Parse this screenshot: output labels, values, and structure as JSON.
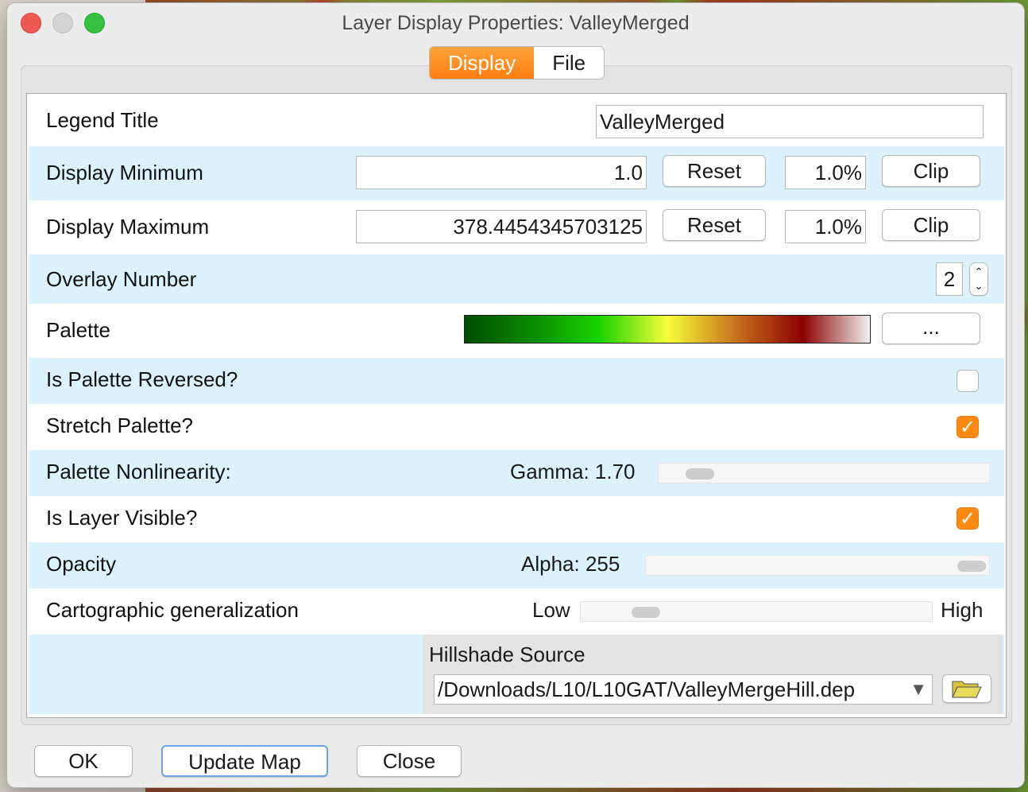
{
  "window": {
    "title": "Layer Display Properties: ValleyMerged"
  },
  "tabs": [
    {
      "label": "Display",
      "active": true
    },
    {
      "label": "File",
      "active": false
    }
  ],
  "rows": {
    "legend_title": {
      "label": "Legend Title",
      "value": "ValleyMerged"
    },
    "display_min": {
      "label": "Display Minimum",
      "value": "1.0",
      "reset_label": "Reset",
      "percent": "1.0%",
      "clip_label": "Clip"
    },
    "display_max": {
      "label": "Display Maximum",
      "value": "378.4454345703125",
      "reset_label": "Reset",
      "percent": "1.0%",
      "clip_label": "Clip"
    },
    "overlay_number": {
      "label": "Overlay Number",
      "value": "2"
    },
    "palette": {
      "label": "Palette",
      "button_label": "...",
      "colors": [
        "#004d00",
        "#0a8a00",
        "#19d400",
        "#f5ff3a",
        "#c8741e",
        "#8b0000",
        "#f0f0f0"
      ]
    },
    "palette_reversed": {
      "label": "Is Palette Reversed?",
      "checked": false
    },
    "stretch_palette": {
      "label": "Stretch Palette?",
      "checked": true
    },
    "nonlinearity": {
      "label": "Palette Nonlinearity:",
      "value_text": "Gamma: 1.70",
      "slider_fraction": 0.08
    },
    "layer_visible": {
      "label": "Is Layer Visible?",
      "checked": true
    },
    "opacity": {
      "label": "Opacity",
      "value_text": "Alpha: 255",
      "slider_fraction": 1.0
    },
    "generalization": {
      "label": "Cartographic generalization",
      "low_label": "Low",
      "high_label": "High",
      "slider_fraction": 0.15
    },
    "hillshade": {
      "label": "Hillshade Source",
      "value": "/Downloads/L10/L10GAT/ValleyMergeHill.dep"
    }
  },
  "footer": {
    "ok_label": "OK",
    "update_label": "Update Map",
    "close_label": "Close"
  },
  "accent": "#ff8a12",
  "row_highlight": "#dcf2fd"
}
